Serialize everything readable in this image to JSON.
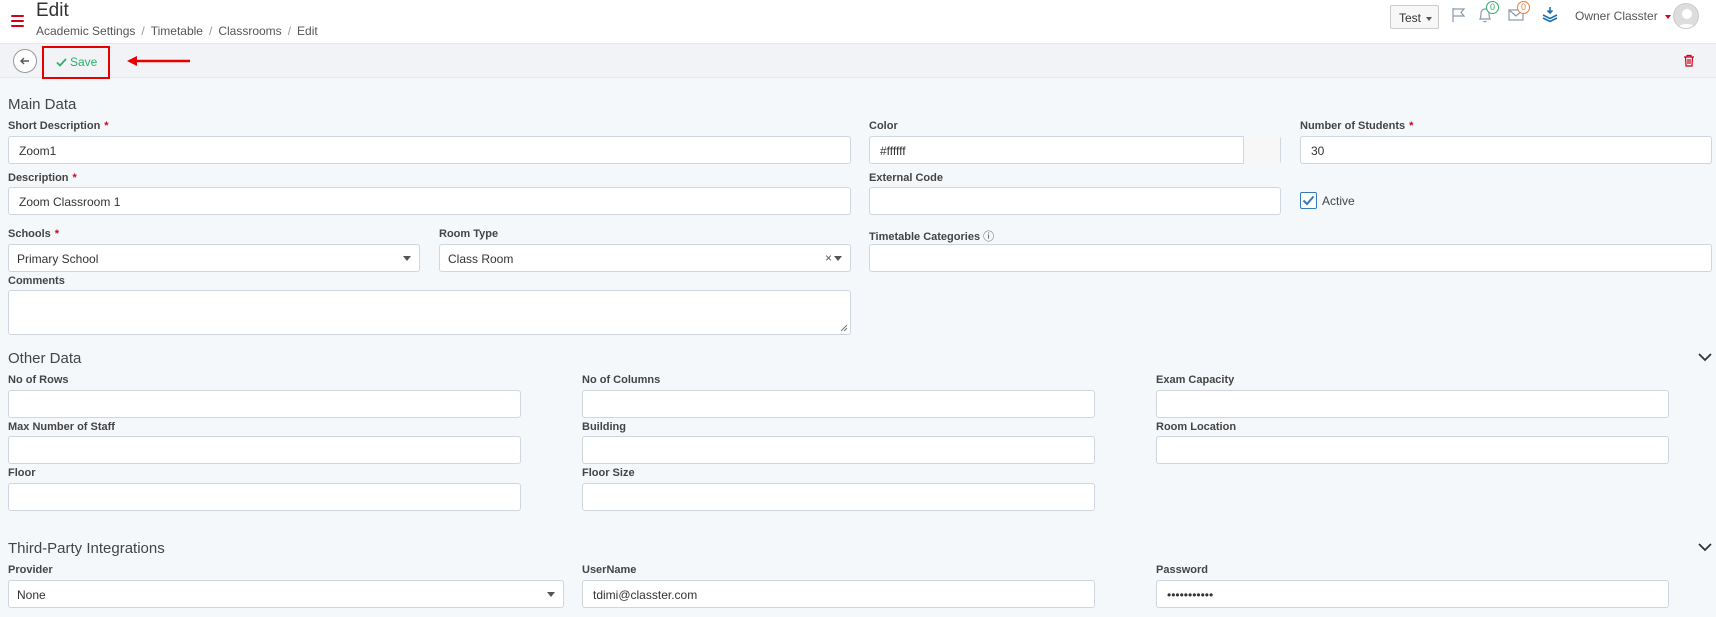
{
  "header": {
    "title": "Edit",
    "breadcrumb": [
      "Academic Settings",
      "Timetable",
      "Classrooms",
      "Edit"
    ],
    "dropdown_label": "Test",
    "notifications_count": "0",
    "messages_count": "0",
    "user_name": "Owner Classter"
  },
  "toolbar": {
    "save_label": "Save"
  },
  "main": {
    "title": "Main Data",
    "short_description": {
      "label": "Short Description",
      "value": "Zoom1"
    },
    "color": {
      "label": "Color",
      "value": "#ffffff"
    },
    "students": {
      "label": "Number of Students",
      "value": "30"
    },
    "description": {
      "label": "Description",
      "value": "Zoom Classroom 1"
    },
    "external_code": {
      "label": "External Code",
      "value": ""
    },
    "active": {
      "label": "Active",
      "checked": true
    },
    "schools": {
      "label": "Schools",
      "value": "Primary School"
    },
    "room_type": {
      "label": "Room Type",
      "value": "Class Room"
    },
    "timetable_categories": {
      "label": "Timetable Categories",
      "value": ""
    },
    "comments": {
      "label": "Comments",
      "value": ""
    }
  },
  "other": {
    "title": "Other Data",
    "rows": {
      "label": "No of Rows",
      "value": ""
    },
    "columns": {
      "label": "No of Columns",
      "value": ""
    },
    "exam_capacity": {
      "label": "Exam Capacity",
      "value": ""
    },
    "max_staff": {
      "label": "Max Number of Staff",
      "value": ""
    },
    "building": {
      "label": "Building",
      "value": ""
    },
    "room_location": {
      "label": "Room Location",
      "value": ""
    },
    "floor": {
      "label": "Floor",
      "value": ""
    },
    "floor_size": {
      "label": "Floor Size",
      "value": ""
    }
  },
  "third_party": {
    "title": "Third-Party Integrations",
    "provider": {
      "label": "Provider",
      "value": "None"
    },
    "username": {
      "label": "UserName",
      "value": "tdimi@classter.com"
    },
    "password": {
      "label": "Password",
      "value": "•••••••••••"
    }
  }
}
